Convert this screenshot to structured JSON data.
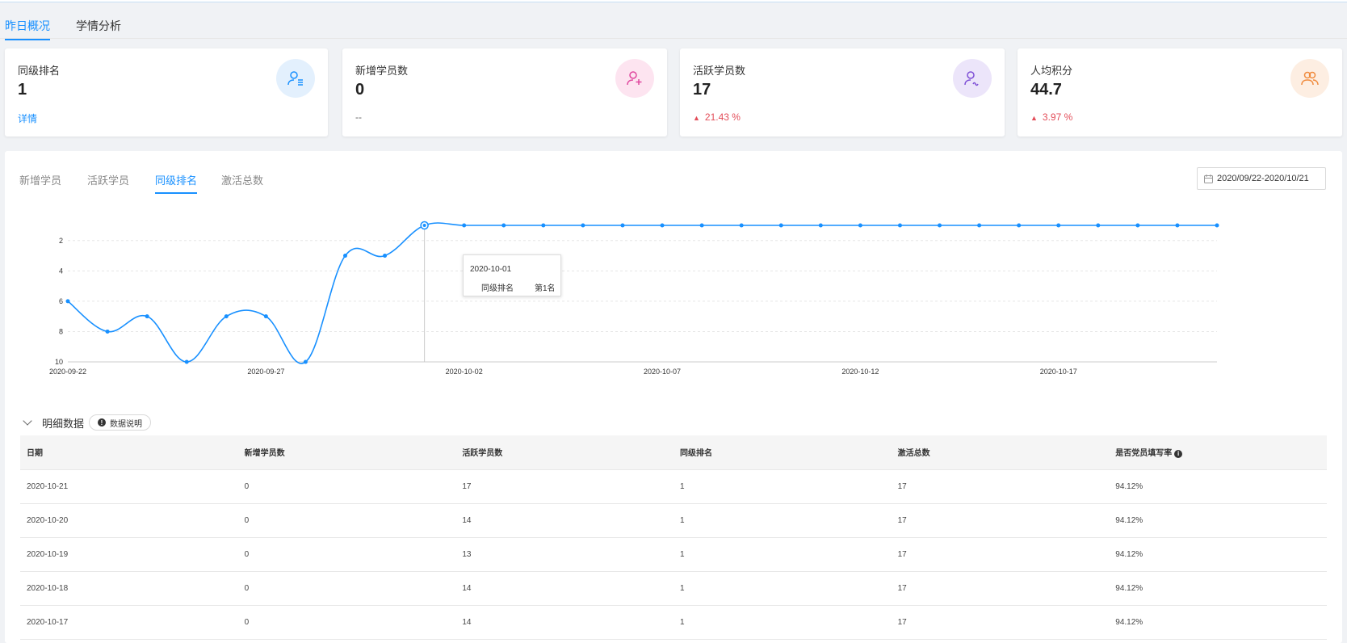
{
  "top_tabs": [
    {
      "label": "昨日概况",
      "active": true
    },
    {
      "label": "学情分析",
      "active": false
    }
  ],
  "cards": [
    {
      "title": "同级排名",
      "value": "1",
      "sub": "详情",
      "sub_type": "link",
      "icon": "user-rank-icon",
      "icon_bg": "#e3f0fd",
      "icon_color": "#1890ff"
    },
    {
      "title": "新增学员数",
      "value": "0",
      "sub": "--",
      "sub_type": "dash",
      "icon": "user-add-icon",
      "icon_bg": "#fde4f0",
      "icon_color": "#e0479e"
    },
    {
      "title": "活跃学员数",
      "value": "17",
      "sub": "21.43 %",
      "sub_type": "up",
      "icon": "user-active-icon",
      "icon_bg": "#ece5fa",
      "icon_color": "#7e4fd6"
    },
    {
      "title": "人均积分",
      "value": "44.7",
      "sub": "3.97 %",
      "sub_type": "up",
      "icon": "users-score-icon",
      "icon_bg": "#fdeee2",
      "icon_color": "#f08a3c"
    }
  ],
  "sub_tabs": [
    {
      "label": "新增学员",
      "active": false
    },
    {
      "label": "活跃学员",
      "active": false
    },
    {
      "label": "同级排名",
      "active": true
    },
    {
      "label": "激活总数",
      "active": false
    }
  ],
  "date_range": "2020/09/22-2020/10/21",
  "chart_data": {
    "type": "line",
    "x": [
      "2020-09-22",
      "2020-09-23",
      "2020-09-24",
      "2020-09-25",
      "2020-09-26",
      "2020-09-27",
      "2020-09-28",
      "2020-09-29",
      "2020-09-30",
      "2020-10-01",
      "2020-10-02",
      "2020-10-03",
      "2020-10-04",
      "2020-10-05",
      "2020-10-06",
      "2020-10-07",
      "2020-10-08",
      "2020-10-09",
      "2020-10-10",
      "2020-10-11",
      "2020-10-12",
      "2020-10-13",
      "2020-10-14",
      "2020-10-15",
      "2020-10-16",
      "2020-10-17",
      "2020-10-18",
      "2020-10-19",
      "2020-10-20",
      "2020-10-21"
    ],
    "x_tick_labels": [
      "2020-09-22",
      "2020-09-27",
      "2020-10-02",
      "2020-10-07",
      "2020-10-12",
      "2020-10-17"
    ],
    "series": [
      {
        "values": [
          6,
          8,
          7,
          10,
          7,
          7,
          10,
          3,
          3,
          1,
          1,
          1,
          1,
          1,
          1,
          1,
          1,
          1,
          1,
          1,
          1,
          1,
          1,
          1,
          1,
          1,
          1,
          1,
          1,
          1
        ],
        "color": "#1890ff"
      }
    ],
    "y_ticks": [
      2,
      4,
      6,
      8,
      10
    ],
    "ylim": [
      1,
      10
    ],
    "y_inverted": true,
    "grid": true,
    "highlight_index": 9,
    "tooltip": {
      "date": "2020-10-01",
      "label": "同级排名",
      "value": "第1名"
    }
  },
  "detail": {
    "title": "明细数据",
    "button": "数据说明"
  },
  "table": {
    "headers": [
      "日期",
      "新增学员数",
      "活跃学员数",
      "同级排名",
      "激活总数",
      "是否党员填写率"
    ],
    "rows": [
      [
        "2020-10-21",
        "0",
        "17",
        "1",
        "17",
        "94.12%"
      ],
      [
        "2020-10-20",
        "0",
        "14",
        "1",
        "17",
        "94.12%"
      ],
      [
        "2020-10-19",
        "0",
        "13",
        "1",
        "17",
        "94.12%"
      ],
      [
        "2020-10-18",
        "0",
        "14",
        "1",
        "17",
        "94.12%"
      ],
      [
        "2020-10-17",
        "0",
        "14",
        "1",
        "17",
        "94.12%"
      ]
    ]
  }
}
